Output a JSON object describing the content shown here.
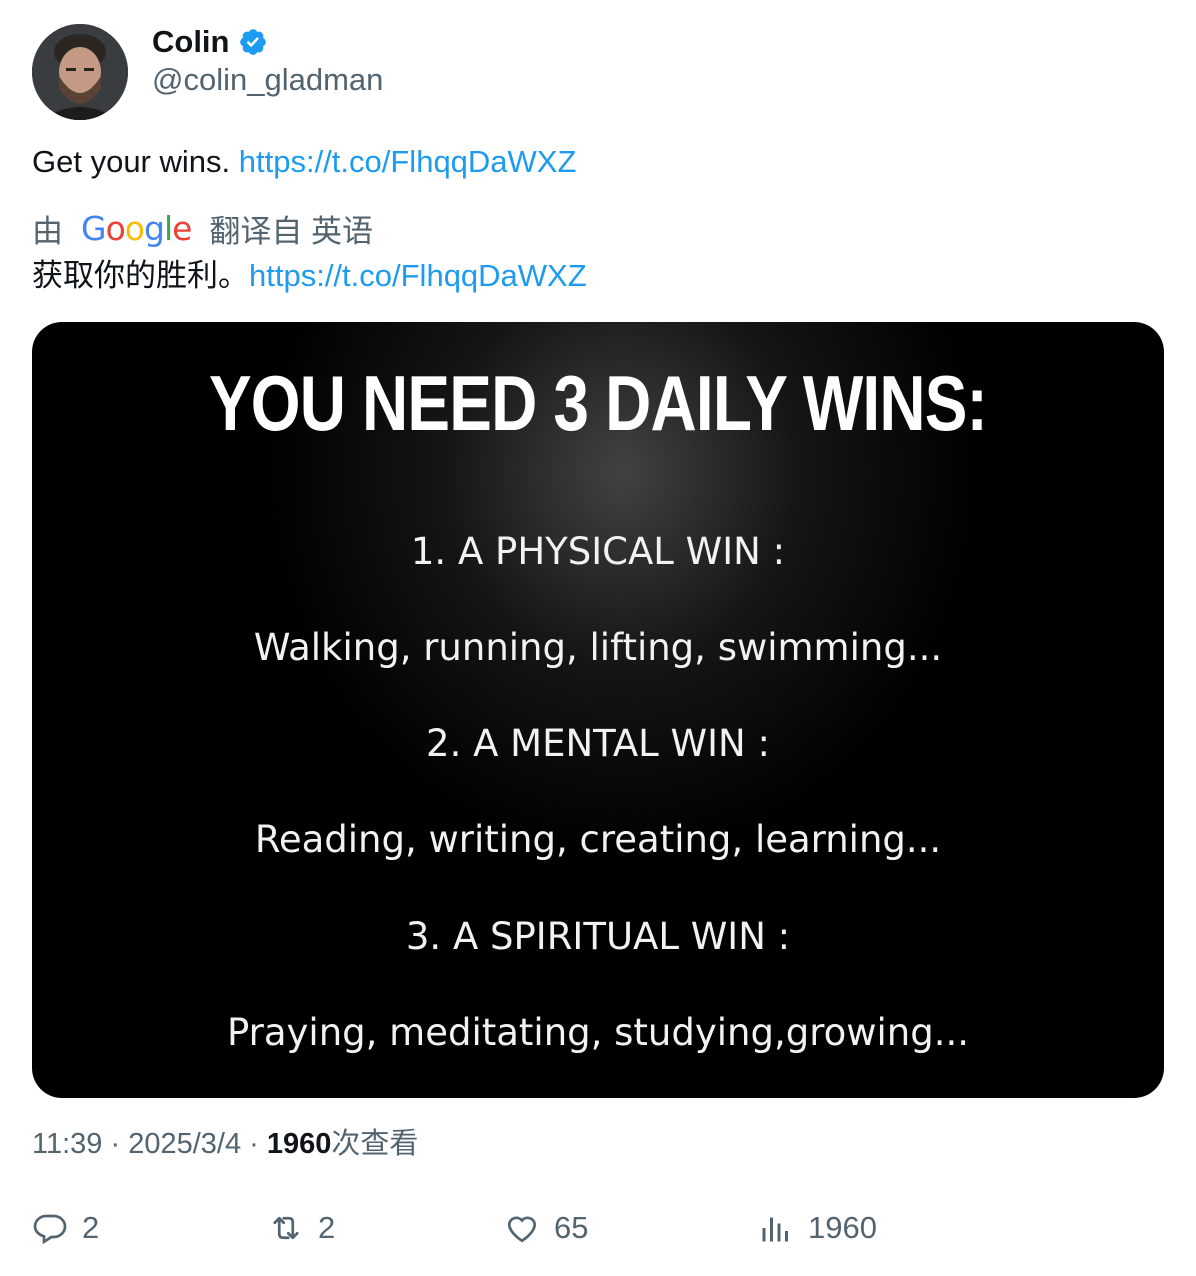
{
  "author": {
    "display_name": "Colin",
    "handle": "@colin_gladman",
    "verified": true,
    "avatar_icon": "avatar-photo"
  },
  "tweet": {
    "text": "Get your wins.",
    "link": "https://t.co/FlhqqDaWXZ"
  },
  "translation": {
    "prefix": "由",
    "provider": "Google",
    "suffix": "翻译自 英语",
    "text": "获取你的胜利。",
    "link": "https://t.co/FlhqqDaWXZ"
  },
  "media": {
    "title": "YOU NEED 3 DAILY WINS:",
    "lines": [
      "1. A PHYSICAL WIN :",
      "Walking, running, lifting, swimming...",
      "2. A MENTAL WIN :",
      "Reading, writing, creating, learning...",
      "3. A SPIRITUAL WIN :",
      "Praying, meditating, studying,growing..."
    ]
  },
  "meta": {
    "time": "11:39",
    "separator": "·",
    "date": "2025/3/4",
    "views_count": "1960",
    "views_label": "次查看"
  },
  "actions": {
    "replies": "2",
    "retweets": "2",
    "likes": "65",
    "views": "1960"
  },
  "colors": {
    "link": "#1d9bf0",
    "secondary_text": "#536471",
    "primary_text": "#0f1419",
    "verified_badge": "#1d9bf0"
  }
}
